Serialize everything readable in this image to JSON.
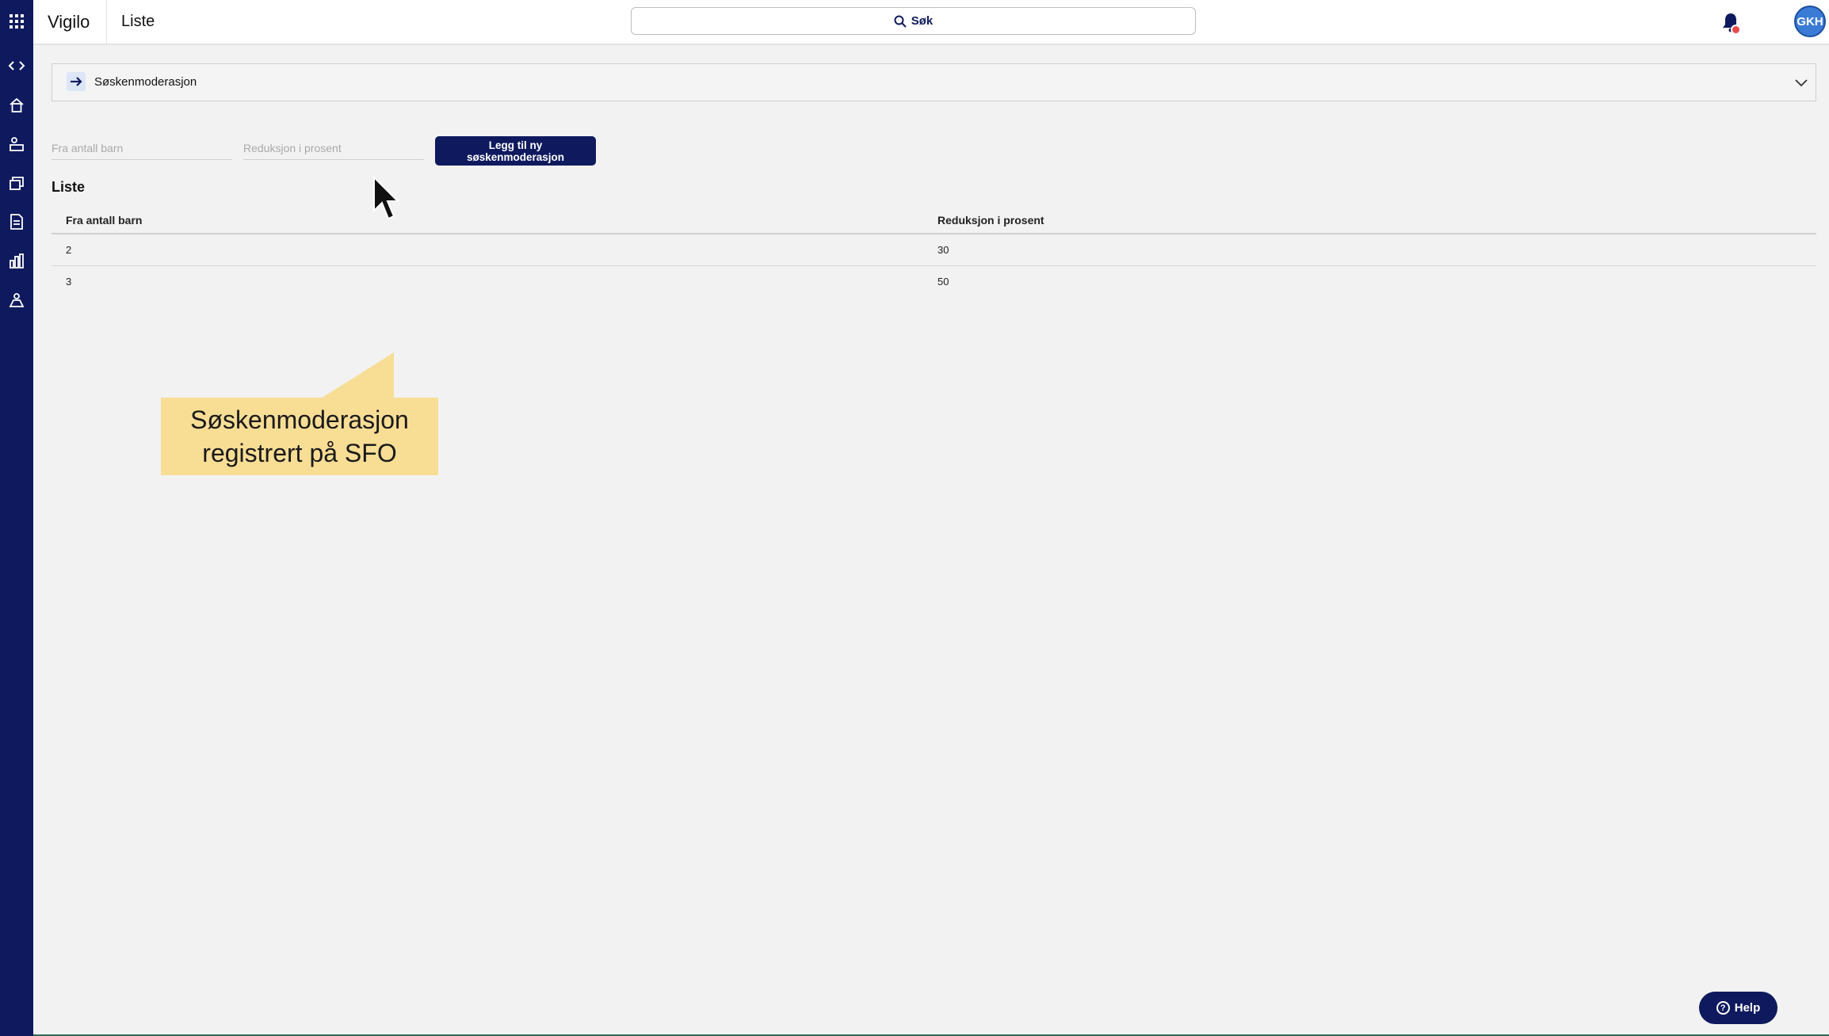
{
  "app": {
    "name": "Vigilo",
    "page_title": "Liste"
  },
  "search": {
    "label": "Søk"
  },
  "user": {
    "initials": "GKH"
  },
  "sidebar": {
    "icons": [
      "apps-grid-icon",
      "expand-collapse-icon",
      "home-icon",
      "user-desk-icon",
      "money-stack-icon",
      "document-icon",
      "bar-chart-icon",
      "organization-icon"
    ]
  },
  "accordion": {
    "title": "Søskenmoderasjon"
  },
  "form": {
    "children_placeholder": "Fra antall barn",
    "reduction_placeholder": "Reduksjon i prosent",
    "add_button": "Legg til ny søskenmoderasjon"
  },
  "list": {
    "heading": "Liste",
    "columns": [
      "Fra antall barn",
      "Reduksjon i prosent"
    ],
    "rows": [
      {
        "children": "2",
        "reduction": "30"
      },
      {
        "children": "3",
        "reduction": "50"
      }
    ]
  },
  "callout": {
    "line1": "Søskenmoderasjon",
    "line2": "registrert på SFO"
  },
  "help": {
    "label": "Help"
  },
  "colors": {
    "navy": "#0f1a5e",
    "callout": "#f8dd95",
    "avatar": "#3a7bd5",
    "badge": "#e84a4a"
  }
}
